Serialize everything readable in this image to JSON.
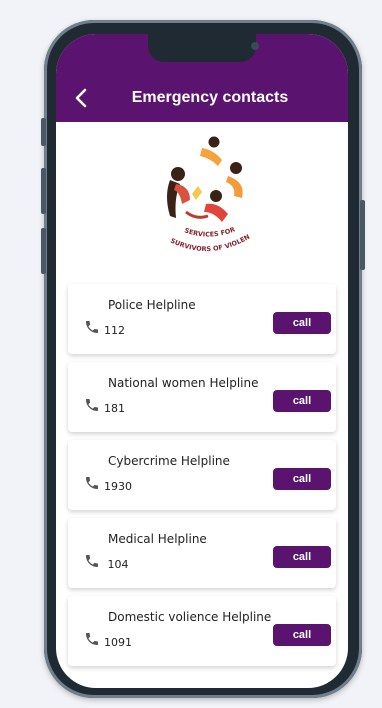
{
  "app": {
    "title": "Emergency contacts",
    "accent_color": "#5a136f"
  },
  "logo": {
    "line1": "SERVICES FOR",
    "line2": "SURVIVORS OF VIOLENCE"
  },
  "contacts": [
    {
      "name": "Police Helpline",
      "number": "112",
      "button": "call"
    },
    {
      "name": "National women Helpline",
      "number": "181",
      "button": "call"
    },
    {
      "name": "Cybercrime Helpline",
      "number": "1930",
      "button": "call"
    },
    {
      "name": "Medical Helpline",
      "number": " 104",
      "button": "call"
    },
    {
      "name": "Domestic volience Helpline",
      "number": "1091",
      "button": "call"
    }
  ],
  "icons": {
    "back": "back-arrow-icon",
    "phone": "phone-icon"
  }
}
